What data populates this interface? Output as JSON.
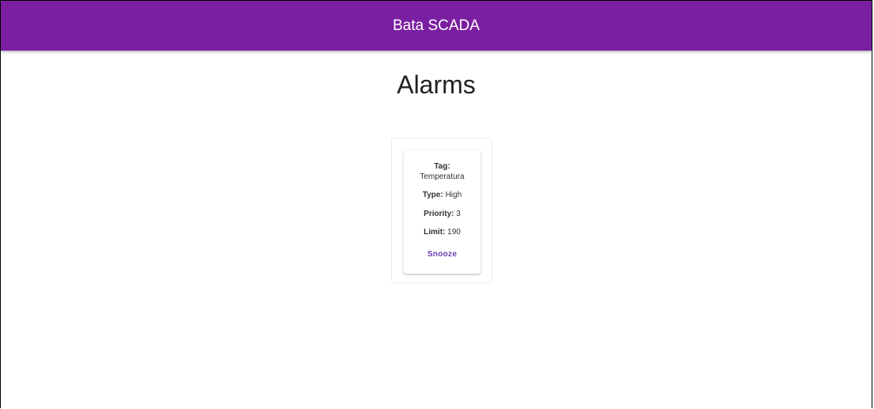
{
  "app": {
    "title": "Bata SCADA",
    "accent_color": "#7b1fa2"
  },
  "page": {
    "title": "Alarms"
  },
  "alarms": [
    {
      "tag_label": "Tag:",
      "tag_value": "Temperatura",
      "type_label": "Type:",
      "type_value": "High",
      "priority_label": "Priority:",
      "priority_value": "3",
      "limit_label": "Limit:",
      "limit_value": "190",
      "snooze_label": "Snooze"
    }
  ]
}
